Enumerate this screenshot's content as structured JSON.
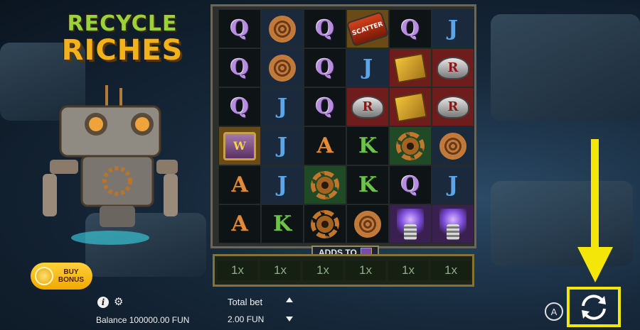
{
  "logo": {
    "line1": "RECYCLE",
    "line2": "RICHES"
  },
  "grid": {
    "rows": [
      [
        "Q",
        "coil",
        "Q",
        "scatter",
        "Q",
        "J"
      ],
      [
        "Q",
        "coil",
        "Q",
        "J",
        "book",
        "wing"
      ],
      [
        "Q",
        "J",
        "Q",
        "wing",
        "book",
        "wing"
      ],
      [
        "chest",
        "J",
        "A",
        "K",
        "gear",
        "coil"
      ],
      [
        "A",
        "J",
        "gear",
        "K",
        "Q",
        "J"
      ],
      [
        "A",
        "K",
        "gear",
        "coil",
        "tesla",
        "tesla"
      ]
    ],
    "backgrounds": [
      [
        "dark",
        "blue",
        "dark",
        "gold",
        "dark",
        "blue"
      ],
      [
        "dark",
        "blue",
        "dark",
        "blue",
        "red",
        "red"
      ],
      [
        "dark",
        "blue",
        "dark",
        "red",
        "red",
        "red"
      ],
      [
        "gold",
        "blue",
        "dark",
        "dark",
        "green",
        "blue"
      ],
      [
        "dark",
        "blue",
        "green",
        "dark",
        "dark",
        "blue"
      ],
      [
        "dark",
        "dark",
        "dark",
        "dark",
        "purple",
        "purple"
      ]
    ],
    "scatter_label": "SCATTER",
    "chest_label": "W",
    "wing_label": "R"
  },
  "adds_to": {
    "label": "ADDS TO"
  },
  "multipliers": [
    "1x",
    "1x",
    "1x",
    "1x",
    "1x",
    "1x"
  ],
  "buy_bonus": {
    "line1": "BUY",
    "line2": "BONUS"
  },
  "footer": {
    "info": "i",
    "settings": "⚙",
    "balance_text": "Balance 100000.00 FUN",
    "total_bet_label": "Total bet",
    "total_bet_value": "2.00 FUN",
    "autoplay": "A"
  },
  "colors": {
    "highlight": "#f5e60a",
    "bonus": "#ffc81e"
  }
}
